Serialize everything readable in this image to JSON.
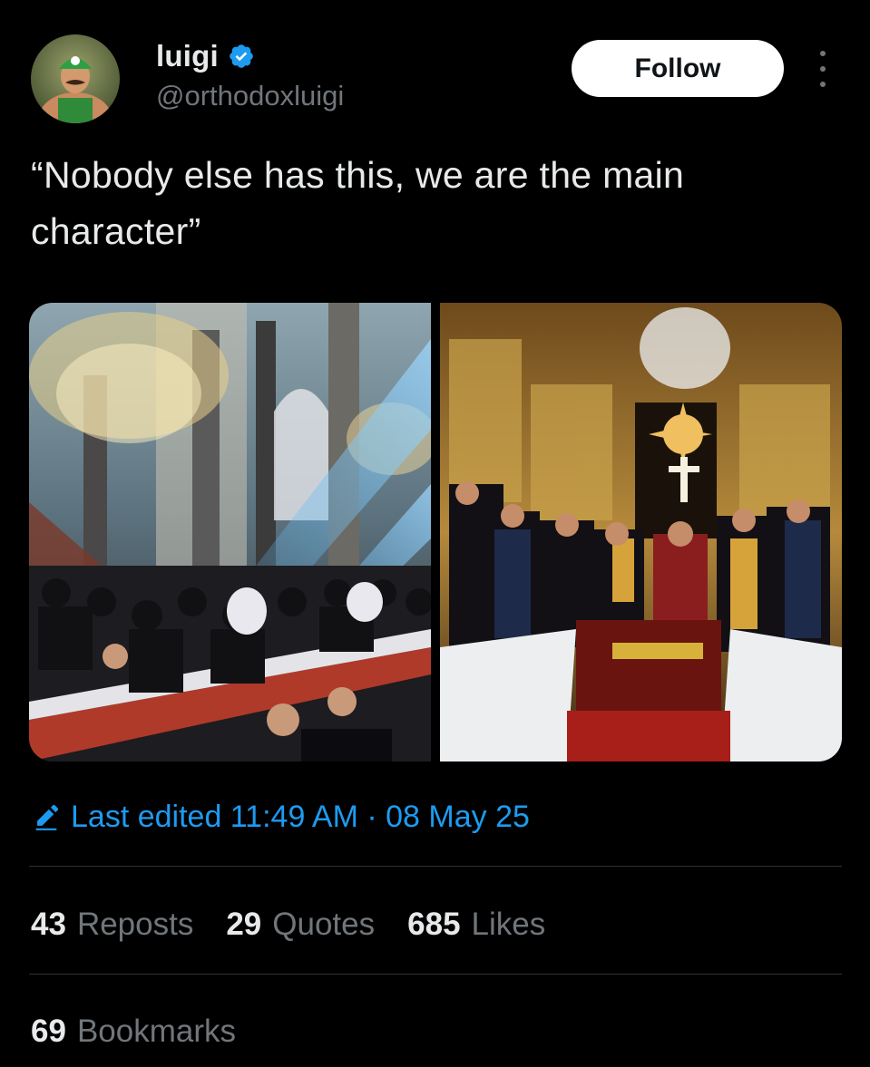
{
  "author": {
    "display_name": "luigi",
    "handle": "@orthodoxluigi",
    "verified": true,
    "avatar_icon": "avatar-luigi"
  },
  "actions": {
    "follow_label": "Follow",
    "more_icon": "more-options-icon"
  },
  "tweet": {
    "text": "“Nobody else has this, we are the main character”"
  },
  "media": [
    {
      "icon": "photo-synod-hall"
    },
    {
      "icon": "photo-synod-altar"
    }
  ],
  "edited": {
    "label": "Last edited 11:49 AM · 08 May 25",
    "icon": "pencil-icon"
  },
  "stats": {
    "reposts": {
      "count": "43",
      "label": "Reposts"
    },
    "quotes": {
      "count": "29",
      "label": "Quotes"
    },
    "likes": {
      "count": "685",
      "label": "Likes"
    },
    "bookmarks": {
      "count": "69",
      "label": "Bookmarks"
    }
  },
  "colors": {
    "background": "#000000",
    "text_primary": "#e7e9ea",
    "text_secondary": "#71767b",
    "accent": "#1d9bf0",
    "divider": "#2f3336"
  }
}
